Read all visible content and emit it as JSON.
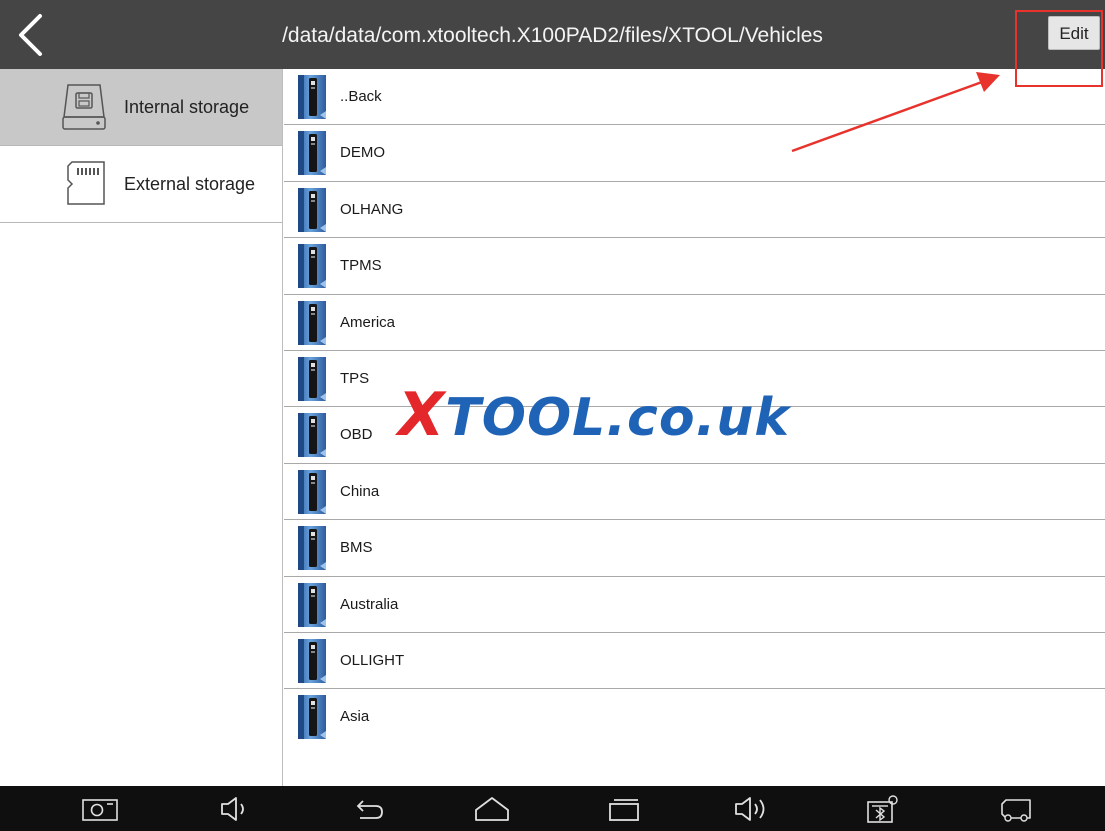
{
  "header": {
    "path": "/data/data/com.xtooltech.X100PAD2/files/XTOOL/Vehicles",
    "edit_label": "Edit",
    "back_icon": "chevron-left-icon"
  },
  "sidebar": {
    "items": [
      {
        "label": "Internal storage",
        "icon": "hard-drive-icon",
        "active": true
      },
      {
        "label": "External storage",
        "icon": "sd-card-icon",
        "active": false
      }
    ]
  },
  "files": [
    {
      "name": "..Back"
    },
    {
      "name": "DEMO"
    },
    {
      "name": "OLHANG"
    },
    {
      "name": "TPMS"
    },
    {
      "name": "America"
    },
    {
      "name": "TPS"
    },
    {
      "name": "OBD"
    },
    {
      "name": "China"
    },
    {
      "name": "BMS"
    },
    {
      "name": "Australia"
    },
    {
      "name": "OLLIGHT"
    },
    {
      "name": "Asia"
    }
  ],
  "watermark": {
    "x_letter": "X",
    "rest": "TOOL.co.uk"
  },
  "annotation": {
    "color": "#e8322c"
  },
  "navbar": {
    "buttons": [
      "camera-icon",
      "volume-down-icon",
      "back-icon",
      "home-icon",
      "recents-icon",
      "volume-up-icon",
      "bluetooth-settings-icon",
      "vci-icon"
    ]
  },
  "colors": {
    "topbar": "#454545",
    "active_sidebar": "#c8c8c8",
    "navbar": "#0f0f0f",
    "watermark_red": "#e3272a",
    "watermark_blue": "#1f63b7"
  }
}
